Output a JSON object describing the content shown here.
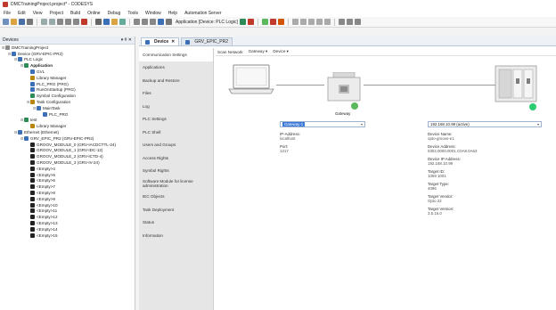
{
  "window": {
    "title": "DMCTrainingProject.project* - CODESYS"
  },
  "menu": [
    "File",
    "Edit",
    "View",
    "Project",
    "Build",
    "Online",
    "Debug",
    "Tools",
    "Window",
    "Help",
    "Automation Server"
  ],
  "toolbar": {
    "application_label": "Application [Device: PLC Logic]"
  },
  "devices_panel": {
    "title": "Devices",
    "controls": "▾ # ✕",
    "tree": [
      {
        "label": "DMCTrainingProject",
        "indent": 0,
        "icon": "project-icon",
        "color": "#8a8a8a",
        "expander": "⊟"
      },
      {
        "label": "Device (GRV-EPIC-PR2)",
        "indent": 1,
        "icon": "device-icon",
        "color": "#3b6fb6",
        "expander": "⊟"
      },
      {
        "label": "PLC Logic",
        "indent": 2,
        "icon": "plc-logic-icon",
        "color": "#3b6fb6",
        "expander": "⊟"
      },
      {
        "label": "Application",
        "indent": 3,
        "icon": "application-icon",
        "color": "#2e8b57",
        "expander": "⊟",
        "bold": true
      },
      {
        "label": "GVL",
        "indent": 4,
        "icon": "gvl-icon",
        "color": "#3b6fb6",
        "expander": ""
      },
      {
        "label": "Library Manager",
        "indent": 4,
        "icon": "library-icon",
        "color": "#b8860b",
        "expander": ""
      },
      {
        "label": "PLC_PRG (PRG)",
        "indent": 4,
        "icon": "program-icon",
        "color": "#3b6fb6",
        "expander": ""
      },
      {
        "label": "RunOnStartup (PRG)",
        "indent": 4,
        "icon": "program-icon",
        "color": "#3b6fb6",
        "expander": ""
      },
      {
        "label": "Symbol Configuration",
        "indent": 4,
        "icon": "symbol-icon",
        "color": "#2e8b57",
        "expander": ""
      },
      {
        "label": "Task Configuration",
        "indent": 4,
        "icon": "task-icon",
        "color": "#b8860b",
        "expander": "⊟"
      },
      {
        "label": "MainTask",
        "indent": 5,
        "icon": "maintask-icon",
        "color": "#3b6fb6",
        "expander": "⊟"
      },
      {
        "label": "PLC_PRG",
        "indent": 6,
        "icon": "call-icon",
        "color": "#3b6fb6",
        "expander": ""
      },
      {
        "label": "test",
        "indent": 3,
        "icon": "application-icon",
        "color": "#2e8b57",
        "expander": "⊟"
      },
      {
        "label": "Library Manager",
        "indent": 4,
        "icon": "library-icon",
        "color": "#b8860b",
        "expander": ""
      },
      {
        "label": "Ethernet (Ethernet)",
        "indent": 2,
        "icon": "ethernet-icon",
        "color": "#3b6fb6",
        "expander": "⊟"
      },
      {
        "label": "GRV_EPIC_PR2 (GRV-EPIC-PR2)",
        "indent": 3,
        "icon": "module-icon",
        "color": "#3b6fb6",
        "expander": "⊟"
      },
      {
        "label": "GROOV_MODULE_0 (GRV-IACDCTTL-24)",
        "indent": 4,
        "icon": "io-module-icon",
        "color": "#222",
        "expander": ""
      },
      {
        "label": "GROOV_MODULE_1 (GRV-IDC-12)",
        "indent": 4,
        "icon": "io-module-icon",
        "color": "#222",
        "expander": ""
      },
      {
        "label": "GROOV_MODULE_2 (GRV-ICTD-4)",
        "indent": 4,
        "icon": "io-module-icon",
        "color": "#222",
        "expander": ""
      },
      {
        "label": "GROOV_MODULE_3 (GRV-IV-24)",
        "indent": 4,
        "icon": "io-module-icon",
        "color": "#222",
        "expander": ""
      },
      {
        "label": "<Empty>4",
        "indent": 4,
        "icon": "empty-slot-icon",
        "color": "#222",
        "expander": ""
      },
      {
        "label": "<Empty>5",
        "indent": 4,
        "icon": "empty-slot-icon",
        "color": "#222",
        "expander": ""
      },
      {
        "label": "<Empty>6",
        "indent": 4,
        "icon": "empty-slot-icon",
        "color": "#222",
        "expander": ""
      },
      {
        "label": "<Empty>7",
        "indent": 4,
        "icon": "empty-slot-icon",
        "color": "#222",
        "expander": ""
      },
      {
        "label": "<Empty>8",
        "indent": 4,
        "icon": "empty-slot-icon",
        "color": "#222",
        "expander": ""
      },
      {
        "label": "<Empty>9",
        "indent": 4,
        "icon": "empty-slot-icon",
        "color": "#222",
        "expander": ""
      },
      {
        "label": "<Empty>10",
        "indent": 4,
        "icon": "empty-slot-icon",
        "color": "#222",
        "expander": ""
      },
      {
        "label": "<Empty>11",
        "indent": 4,
        "icon": "empty-slot-icon",
        "color": "#222",
        "expander": ""
      },
      {
        "label": "<Empty>12",
        "indent": 4,
        "icon": "empty-slot-icon",
        "color": "#222",
        "expander": ""
      },
      {
        "label": "<Empty>13",
        "indent": 4,
        "icon": "empty-slot-icon",
        "color": "#222",
        "expander": ""
      },
      {
        "label": "<Empty>14",
        "indent": 4,
        "icon": "empty-slot-icon",
        "color": "#222",
        "expander": ""
      },
      {
        "label": "<Empty>15",
        "indent": 4,
        "icon": "empty-slot-icon",
        "color": "#222",
        "expander": ""
      }
    ]
  },
  "editor": {
    "tabs": [
      {
        "label": "Device",
        "active": true,
        "close": "✕"
      },
      {
        "label": "GRV_EPIC_PR2",
        "active": false,
        "close": ""
      }
    ],
    "nav": [
      "Communication Settings",
      "Applications",
      "Backup and Restore",
      "Files",
      "Log",
      "PLC Settings",
      "PLC Shell",
      "Users and Groups",
      "Access Rights",
      "Symbol Rights",
      "Software Module for license administration",
      "IEC Objects",
      "Task Deployment",
      "Status",
      "Information"
    ],
    "breadcrumbs": [
      "Scan Network",
      "Gateway ▾",
      "Device ▾"
    ],
    "gateway": {
      "label": "Gateway",
      "combo": "Gateway-1",
      "ip_label": "IP-Address:",
      "ip_value": "localhost",
      "port_label": "Port:",
      "port_value": "1217"
    },
    "device": {
      "combo": "192.168.10.99 (active)",
      "fields": [
        {
          "label": "Device Name:",
          "value": "opto-groove-e1"
        },
        {
          "label": "Device Address:",
          "value": "0302.0000.0001.C0A8.0A63"
        },
        {
          "label": "Device IP Address:",
          "value": "192.168.10.99"
        },
        {
          "label": "Target ID:",
          "value": "1069 1001"
        },
        {
          "label": "Target Type:",
          "value": "4096"
        },
        {
          "label": "Target Vendor:",
          "value": "Opto 22"
        },
        {
          "label": "Target Version:",
          "value": "3.5.16.0"
        }
      ]
    },
    "status_colors": {
      "gateway": "#5cb85c",
      "device": "#2ecc71"
    }
  }
}
